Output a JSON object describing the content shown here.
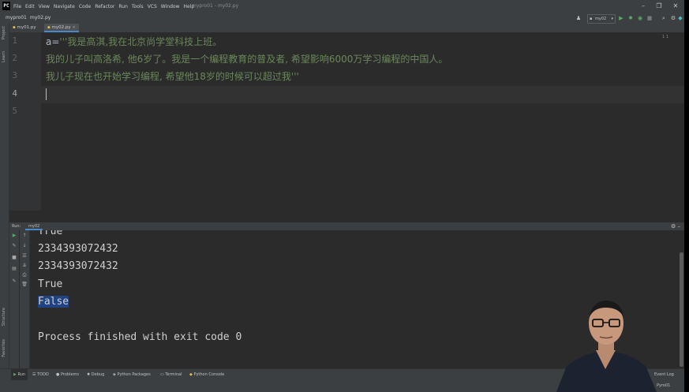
{
  "menubar": {
    "items": [
      "File",
      "Edit",
      "View",
      "Navigate",
      "Code",
      "Refactor",
      "Run",
      "Tools",
      "VCS",
      "Window",
      "Help"
    ],
    "window_title": "mypro01 - my02.py"
  },
  "navbar": {
    "project": "mypro01",
    "file": "my02.py",
    "run_config": "my02"
  },
  "left_strip": {
    "labels": [
      "Project",
      "Learn",
      "Structure",
      "Favorites"
    ]
  },
  "tabs": [
    {
      "label": "my01.py",
      "active": false
    },
    {
      "label": "my02.py",
      "active": true
    }
  ],
  "editor": {
    "inspection_counts": "1  1",
    "line_numbers": [
      "1",
      "2",
      "3",
      "4",
      "5"
    ],
    "lines": {
      "l1_var": "a",
      "l1_op": "=",
      "l1_str": "'''我是高淇,我在北京尚学堂科技上班。",
      "l2": "我的儿子叫高洛希, 他6岁了。我是一个编程教育的普及者, 希望影响6000万学习编程的中国人。",
      "l3": "我儿子现在也开始学习编程, 希望他18岁的时候可以超过我'''"
    }
  },
  "run_panel": {
    "label": "Run:",
    "tab": "my02",
    "output": [
      "True",
      "2334393072432",
      "2334393072432",
      "True",
      "False",
      "",
      "Process finished with exit code 0"
    ],
    "selected_line_index": 4
  },
  "bottom_bar": {
    "items": [
      "Run",
      "TODO",
      "Problems",
      "Debug",
      "Python Packages",
      "Terminal",
      "Python Console"
    ],
    "active_index": 0,
    "event_log": "Event Log"
  },
  "status_bar": {
    "text": "Pyro01"
  },
  "colors": {
    "string_green": "#6a8759",
    "selection_blue": "#214283",
    "accent_blue": "#4a88c7"
  }
}
